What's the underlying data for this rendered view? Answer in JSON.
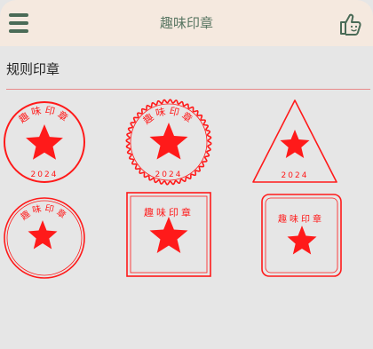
{
  "header": {
    "title": "趣味印章",
    "menu_icon": "hamburger-menu-icon",
    "like_icon": "thumbs-up-icon"
  },
  "section": {
    "title": "规则印章"
  },
  "seal_color": "#ff1a1a",
  "seals": [
    {
      "name": "circle-seal",
      "shape": "circle",
      "top_text": "趣味印章",
      "bottom_text": "2024"
    },
    {
      "name": "wavy-circle-seal",
      "shape": "wavy-circle",
      "top_text": "趣味印章",
      "bottom_text": "2024"
    },
    {
      "name": "triangle-seal",
      "shape": "triangle",
      "top_text": "",
      "bottom_text": "2024"
    },
    {
      "name": "double-circle-seal",
      "shape": "double-circle",
      "top_text": "趣味印章",
      "bottom_text": ""
    },
    {
      "name": "square-seal",
      "shape": "square",
      "top_text": "趣味印章",
      "bottom_text": ""
    },
    {
      "name": "rounded-square-seal",
      "shape": "rounded-square",
      "top_text": "趣味印章",
      "bottom_text": ""
    }
  ]
}
